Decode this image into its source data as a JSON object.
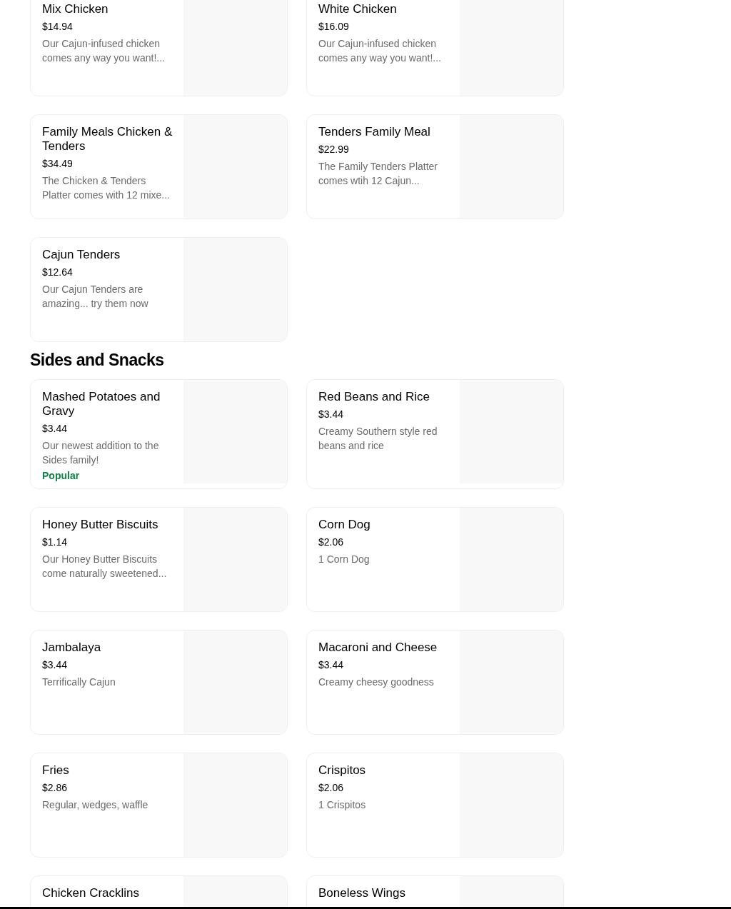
{
  "sections": [
    {
      "items": [
        {
          "name": "Mix Chicken",
          "price": "$14.94",
          "description": "Our Cajun-infused chicken comes any way you want!..."
        },
        {
          "name": "White Chicken",
          "price": "$16.09",
          "description": "Our Cajun-infused chicken comes any way you want!..."
        },
        {
          "name": "Family Meals Chicken & Tenders",
          "price": "$34.49",
          "description": "The Chicken & Tenders Platter comes with 12 mixe..."
        },
        {
          "name": "Tenders Family Meal",
          "price": "$22.99",
          "description": "The Family Tenders Platter comes wtih 12 Cajun..."
        },
        {
          "name": "Cajun Tenders",
          "price": "$12.64",
          "description": "Our Cajun Tenders are amazing... try them now"
        }
      ]
    },
    {
      "title": "Sides and Snacks",
      "items": [
        {
          "name": "Mashed Potatoes and Gravy",
          "price": "$3.44",
          "description": "Our newest addition to the Sides family!",
          "badge": "Popular"
        },
        {
          "name": "Red Beans and Rice",
          "price": "$3.44",
          "description": "Creamy Southern style red beans and rice"
        },
        {
          "name": "Honey Butter Biscuits",
          "price": "$1.14",
          "description": "Our Honey Butter Biscuits come naturally sweetened..."
        },
        {
          "name": "Corn Dog",
          "price": "$2.06",
          "description": "1 Corn Dog"
        },
        {
          "name": "Jambalaya",
          "price": "$3.44",
          "description": "Terrifically Cajun"
        },
        {
          "name": "Macaroni and Cheese",
          "price": "$3.44",
          "description": "Creamy cheesy goodness"
        },
        {
          "name": "Fries",
          "price": "$2.86",
          "description": "Regular, wedges, waffle"
        },
        {
          "name": "Crispitos",
          "price": "$2.06",
          "description": "1 Crispitos"
        },
        {
          "name": "Chicken Cracklins"
        },
        {
          "name": "Boneless Wings"
        }
      ]
    }
  ]
}
